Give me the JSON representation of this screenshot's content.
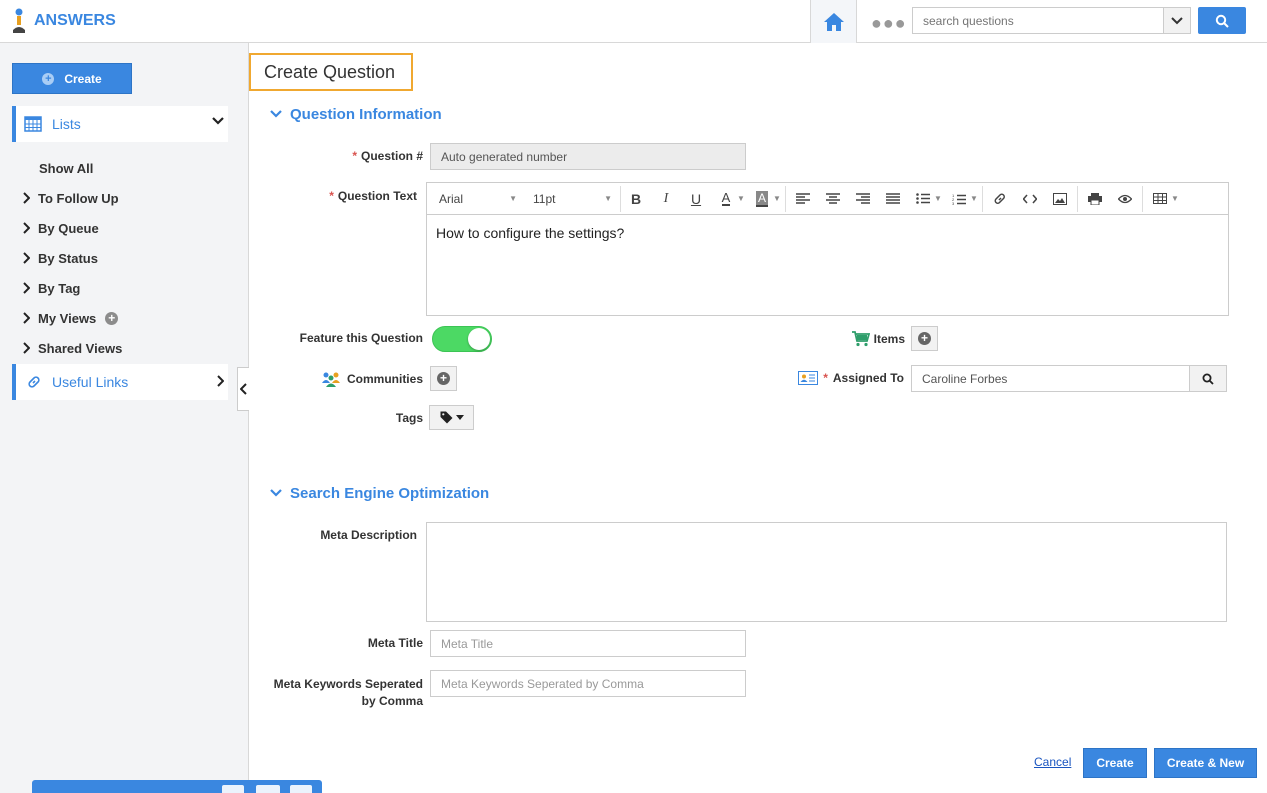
{
  "app": {
    "title": "ANSWERS",
    "accent": "#3a87e0"
  },
  "header": {
    "search_placeholder": "search questions",
    "more_icon": "ellipsis-icon",
    "home_icon": "home-icon"
  },
  "sidebar": {
    "create_label": "Create",
    "lists_label": "Lists",
    "items": [
      {
        "label": "Show All"
      },
      {
        "label": "To Follow Up"
      },
      {
        "label": "By Queue"
      },
      {
        "label": "By Status"
      },
      {
        "label": "By Tag"
      },
      {
        "label": "My Views"
      },
      {
        "label": "Shared Views"
      }
    ],
    "useful_links_label": "Useful Links"
  },
  "page": {
    "title": "Create Question"
  },
  "question_info": {
    "heading": "Question Information",
    "question_number_label": "Question #",
    "question_number_value": "Auto generated number",
    "question_text_label": "Question Text",
    "editor": {
      "font": "Arial",
      "size": "11pt",
      "content": "How to configure the settings?"
    },
    "feature_label": "Feature this Question",
    "feature_on": true,
    "items_label": "Items",
    "communities_label": "Communities",
    "assigned_to_label": "Assigned To",
    "assigned_to_value": "Caroline Forbes",
    "tags_label": "Tags"
  },
  "seo": {
    "heading": "Search Engine Optimization",
    "meta_description_label": "Meta Description",
    "meta_title_label": "Meta Title",
    "meta_title_placeholder": "Meta Title",
    "meta_keywords_label_line1": "Meta Keywords Seperated",
    "meta_keywords_label_line2": "by Comma",
    "meta_keywords_placeholder": "Meta Keywords Seperated by Comma"
  },
  "actions": {
    "cancel": "Cancel",
    "create": "Create",
    "create_new": "Create & New"
  }
}
